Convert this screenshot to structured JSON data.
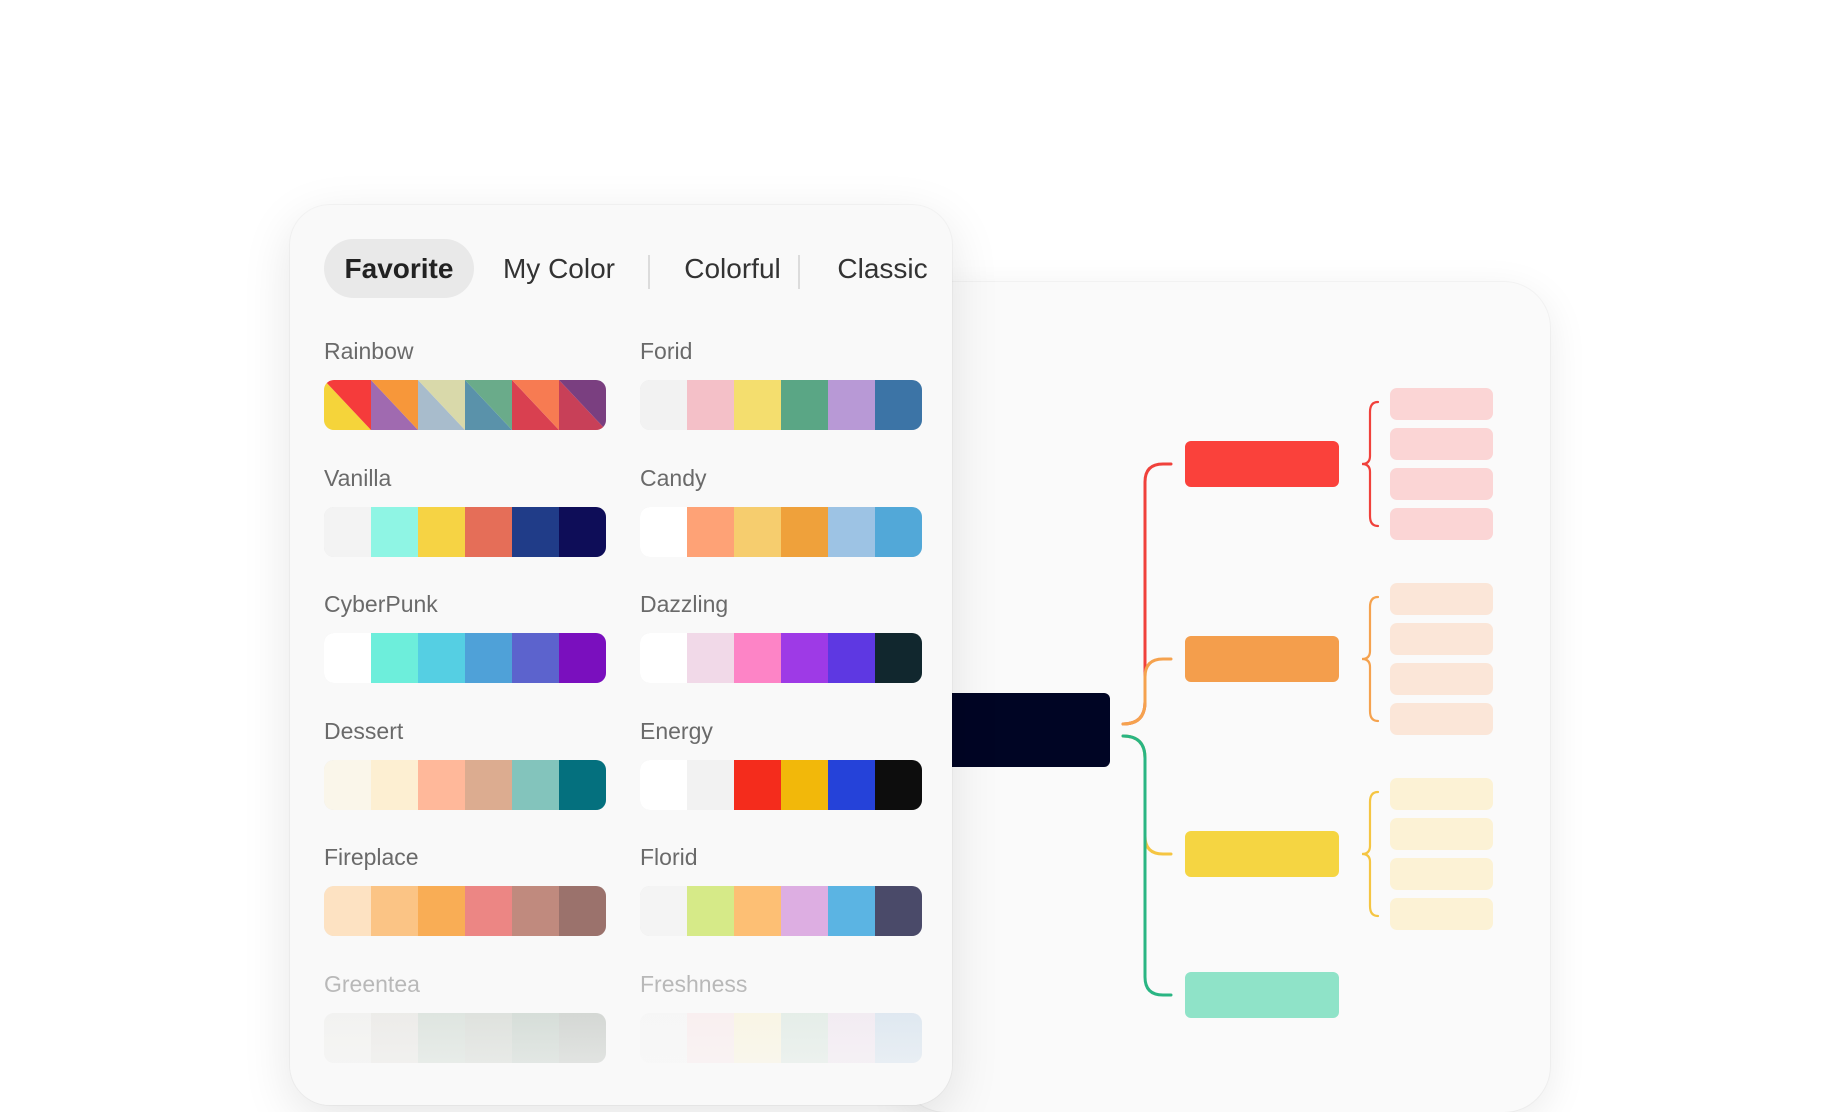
{
  "tabs": [
    {
      "label": "Favorite",
      "active": true
    },
    {
      "label": "My Color",
      "active": false
    },
    {
      "label": "Colorful",
      "active": false
    },
    {
      "label": "Classic",
      "active": false
    }
  ],
  "themes": [
    {
      "name": "Rainbow",
      "colors": [
        "#f53b3b",
        "#f7973a",
        "#d9d9aa",
        "#6aab8a",
        "#f77b52",
        "#7a3f80"
      ],
      "colors2": [
        "#f5d43a",
        "#a06ab0",
        "#a8bccc",
        "#5a92aa",
        "#d94050",
        "#c84058"
      ],
      "diagonal": true
    },
    {
      "name": "Forid",
      "colors": [
        "#f2f2f2",
        "#f4c0c8",
        "#f4de6e",
        "#5aa685",
        "#b899d6",
        "#3c74a6"
      ]
    },
    {
      "name": "Vanilla",
      "colors": [
        "#f3f3f3",
        "#8ff5e4",
        "#f6d344",
        "#e56e58",
        "#203c88",
        "#0e0d58"
      ]
    },
    {
      "name": "Candy",
      "colors": [
        "#ffffff",
        "#fea276",
        "#f6cd6e",
        "#efa13b",
        "#9dc3e4",
        "#52a8d8"
      ]
    },
    {
      "name": "CyberPunk",
      "colors": [
        "#ffffff",
        "#6deedb",
        "#55cfe3",
        "#4fa1d8",
        "#5c63cd",
        "#7a0fbe"
      ]
    },
    {
      "name": "Dazzling",
      "colors": [
        "#ffffff",
        "#f1d9e8",
        "#fd84c6",
        "#9e3ae6",
        "#5e38e2",
        "#11272e"
      ]
    },
    {
      "name": "Dessert",
      "colors": [
        "#faf6ea",
        "#fdefd2",
        "#ffb89a",
        "#dcac90",
        "#83c4bc",
        "#04707e"
      ]
    },
    {
      "name": "Energy",
      "colors": [
        "#ffffff",
        "#f2f2f2",
        "#f42c1c",
        "#f2b80a",
        "#2542d9",
        "#0d0d0d"
      ]
    },
    {
      "name": "Fireplace",
      "colors": [
        "#fde2c2",
        "#fbc485",
        "#f9ad55",
        "#ec8684",
        "#c08a7e",
        "#9b726c"
      ]
    },
    {
      "name": "Florid",
      "colors": [
        "#f4f4f4",
        "#d6ea88",
        "#fdbf74",
        "#ddaee2",
        "#5bb4e3",
        "#4a4a69"
      ]
    },
    {
      "name": "Greentea",
      "colors": [
        "#e8e8e4",
        "#d8d6d0",
        "#b3c6b8",
        "#b4bcb2",
        "#9eb2a4",
        "#9aa19a"
      ]
    },
    {
      "name": "Freshness",
      "colors": [
        "#f4f4f4",
        "#fbe0e2",
        "#fbf0c6",
        "#c6dccd",
        "#e8d6e8",
        "#b5cde3"
      ]
    }
  ],
  "mindmap": {
    "root_color": "#000524",
    "branches": [
      {
        "color": "#fa413b",
        "sub_color": "#fbd5d5",
        "line_color": "#f0413b",
        "subs": 4
      },
      {
        "color": "#f49e4c",
        "sub_color": "#fbe6d8",
        "line_color": "#f5a24e",
        "subs": 4
      },
      {
        "color": "#f5d542",
        "sub_color": "#fcf2d5",
        "line_color": "#f5c542",
        "subs": 4
      },
      {
        "color": "#8fe3c8",
        "sub_color": "#fcf2d5",
        "line_color": "#2ab583",
        "subs": 0
      }
    ]
  }
}
